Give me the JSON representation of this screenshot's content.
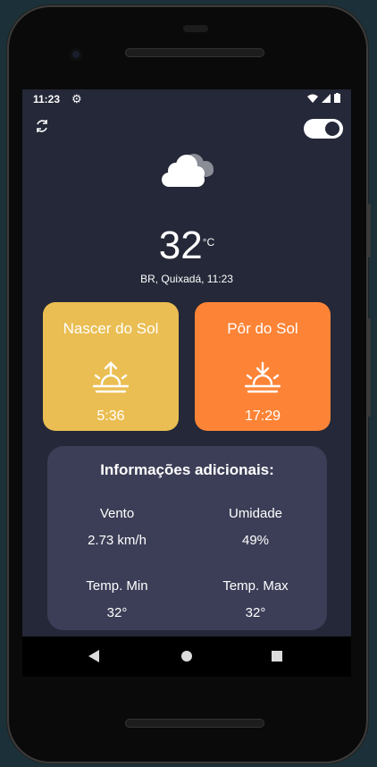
{
  "status_bar": {
    "time": "11:23",
    "icons": [
      "gear-icon",
      "wifi-icon",
      "signal-icon",
      "battery-icon"
    ]
  },
  "toolbar": {
    "refresh_icon": "refresh-icon",
    "theme_toggle_on": true
  },
  "weather": {
    "icon": "cloud-icon",
    "temperature": "32",
    "unit": "°C",
    "location": "BR, Quixadá, 11:23"
  },
  "cards": {
    "sunrise": {
      "title": "Nascer do Sol",
      "value": "5:36",
      "color": "#eabe52",
      "icon": "sunrise-icon"
    },
    "sunset": {
      "title": "Pôr do Sol",
      "value": "17:29",
      "color": "#fd8437",
      "icon": "sunset-icon"
    }
  },
  "info": {
    "title": "Informações adicionais:",
    "wind": {
      "label": "Vento",
      "value": "2.73 km/h"
    },
    "humidity": {
      "label": "Umidade",
      "value": "49%"
    },
    "temp_min": {
      "label": "Temp. Min",
      "value": "32°"
    },
    "temp_max": {
      "label": "Temp. Max",
      "value": "32°"
    }
  },
  "colors": {
    "background": "#242838",
    "panel": "#3c3e57",
    "accent_sunrise": "#eabe52",
    "accent_sunset": "#fd8437"
  },
  "nav": [
    "back-icon",
    "home-icon",
    "recents-icon"
  ]
}
